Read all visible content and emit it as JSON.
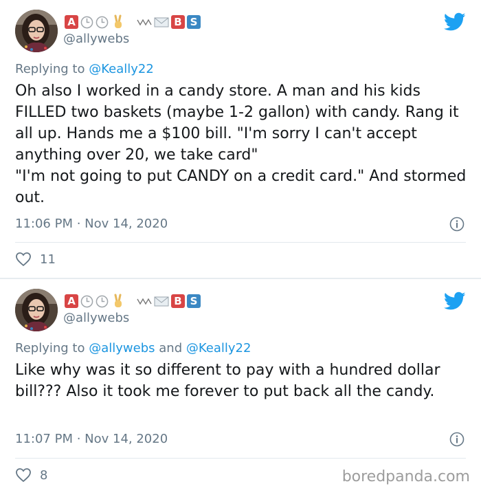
{
  "tweets": [
    {
      "display_badges": [
        "A",
        "B",
        "S"
      ],
      "handle": "@allywebs",
      "replying_label": "Replying to",
      "replying_to": "@Keally22",
      "text": "Oh also I worked in a candy store. A man and his kids FILLED two baskets (maybe 1-2 gallon) with candy. Rang it all up. Hands me a $100 bill. \"I'm sorry I can't accept anything over 20, we take card\"\n\"I'm not going to put CANDY on a credit card.\" And stormed out.",
      "timestamp": "11:06 PM · Nov 14, 2020",
      "likes": "11"
    },
    {
      "display_badges": [
        "A",
        "B",
        "S"
      ],
      "handle": "@allywebs",
      "replying_label": "Replying to",
      "replying_to_1": "@allywebs",
      "replying_and": "and",
      "replying_to_2": "@Keally22",
      "text": "Like why was it so different to pay with a hundred dollar bill??? Also it took me forever to put back all the candy.",
      "timestamp": "11:07 PM · Nov 14, 2020",
      "likes": "8"
    }
  ],
  "icons": {
    "bird": "twitter-bird-icon",
    "info": "info-icon",
    "heart": "heart-icon",
    "clock": "clock-icon",
    "peace": "victory-hand-icon",
    "mail": "envelope-icon"
  },
  "colors": {
    "twitter_blue": "#1da1f2",
    "badge_red": "#d84545",
    "badge_blue": "#3b88c3",
    "muted": "#657786"
  },
  "watermark": "boredpanda.com"
}
